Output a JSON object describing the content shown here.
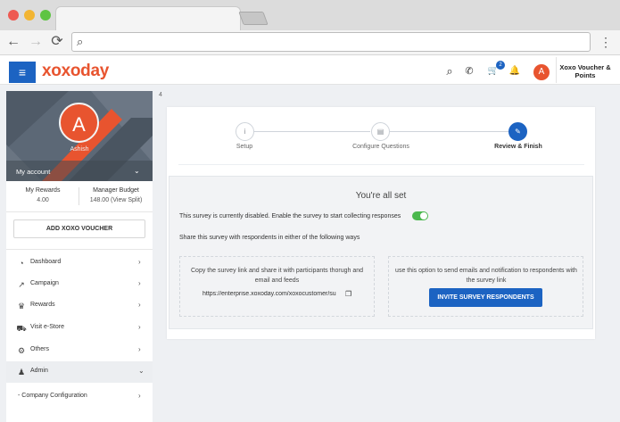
{
  "browser": {
    "back_icon": "←",
    "forward_icon": "→",
    "reload_icon": "⟳",
    "search_icon": "⌕",
    "menu_icon": "⋮"
  },
  "header": {
    "logo": "xoxoday",
    "menu_icon": "≡",
    "search_icon": "⌕",
    "phone_icon": "✆",
    "cart_icon": "🛒",
    "cart_count": "2",
    "bell_icon": "🔔",
    "avatar_initial": "A",
    "voucher_label": "Xoxo Voucher & Points",
    "accent": "#1c63c2",
    "brand": "#e8542f"
  },
  "breadcrumb_number": "4",
  "sidebar": {
    "avatar_initial": "A",
    "user_name": "Ashish",
    "my_account": "My account",
    "stats": [
      {
        "label": "My Rewards",
        "value": "4.00"
      },
      {
        "label": "Manager Budget",
        "value": "148.00 (View Split)"
      }
    ],
    "add_voucher_button": "ADD XOXO VOUCHER",
    "items": [
      {
        "label": "Dashboard",
        "icon": "◔"
      },
      {
        "label": "Campaign",
        "icon": "↗"
      },
      {
        "label": "Rewards",
        "icon": "♛"
      },
      {
        "label": "Visit e-Store",
        "icon": "⛟"
      },
      {
        "label": "Others",
        "icon": "⚙"
      },
      {
        "label": "Admin",
        "icon": "♟"
      }
    ],
    "subitems": [
      {
        "label": "- Company Configuration"
      }
    ]
  },
  "steps": [
    {
      "label": "Setup",
      "icon": "i"
    },
    {
      "label": "Configure Questions",
      "icon": "▤"
    },
    {
      "label": "Review & Finish",
      "icon": "✎"
    }
  ],
  "main": {
    "title": "You're all set",
    "disabled_message": "This survey is currently disabled. Enable the survey to start collecting responses",
    "share_message": "Share this survey with respondents in either of the following ways",
    "copy_text": "Copy the survey link and share it with participants thorugh and email and feeds",
    "survey_link": "https://enterprise.xoxoday.com/xoxocustomer/su",
    "copy_icon": "❐",
    "email_text": "use this option to send emails and notification to respondents with the survey link",
    "invite_button": "INVITE SURVEY RESPONDENTS",
    "toggle_on": true
  }
}
